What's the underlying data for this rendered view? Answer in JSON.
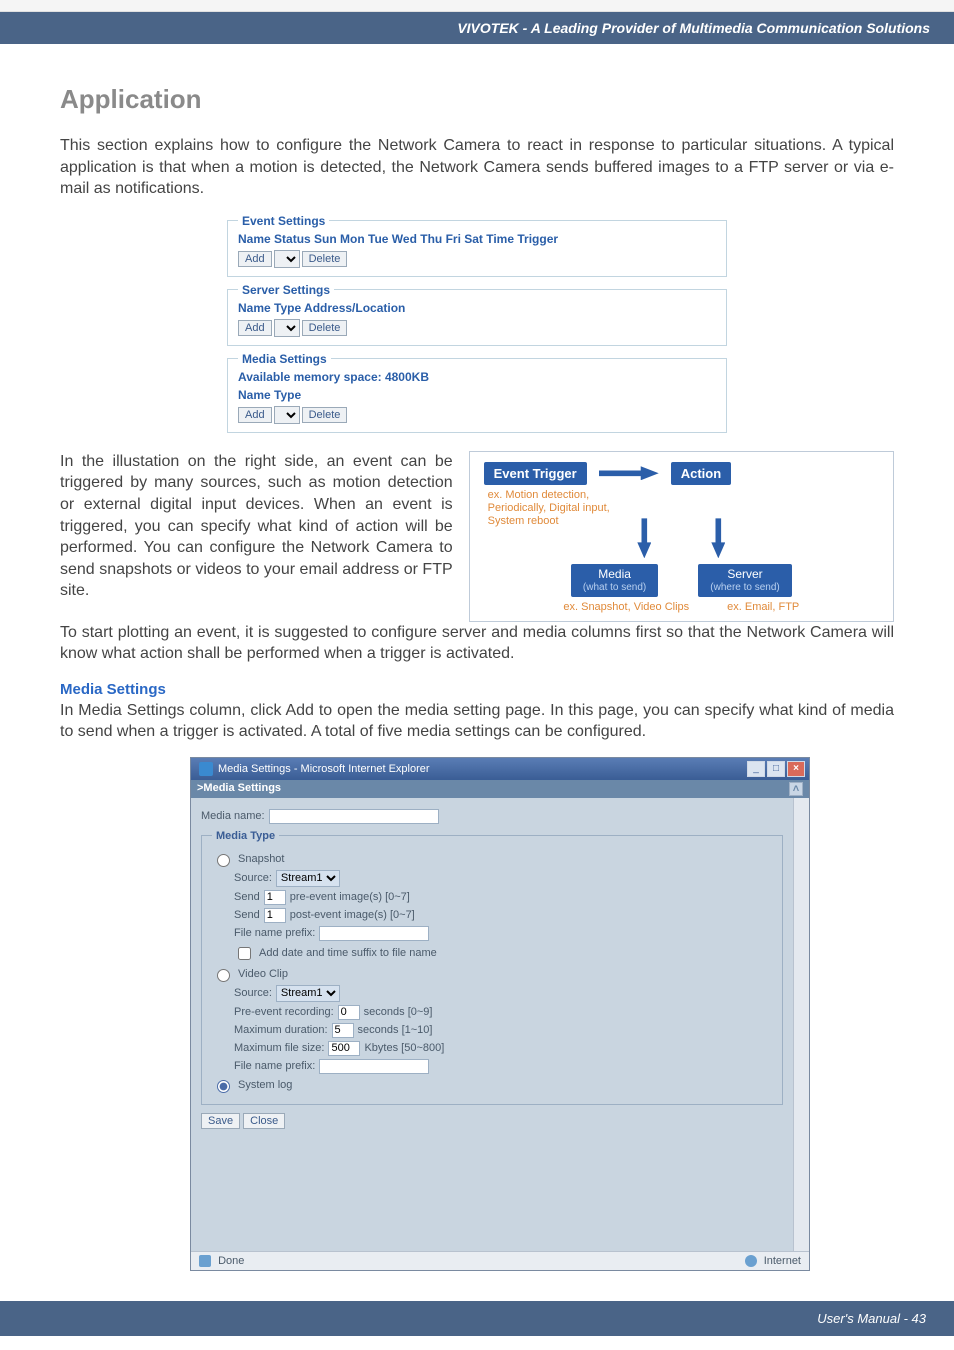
{
  "header": {
    "text": "VIVOTEK - A Leading Provider of Multimedia Communication Solutions"
  },
  "title": "Application",
  "intro": "This section explains how to configure the Network Camera to react in response to particular situations. A typical application is that when a motion is detected, the Network Camera sends buffered images to a FTP server or via e-mail as notifications.",
  "event_settings": {
    "legend": "Event Settings",
    "header_row": "Name Status Sun Mon Tue Wed Thu Fri Sat Time Trigger",
    "add": "Add",
    "delete": "Delete"
  },
  "server_settings": {
    "legend": "Server Settings",
    "header_row": "Name Type Address/Location",
    "add": "Add",
    "delete": "Delete"
  },
  "media_settings_box": {
    "legend": "Media Settings",
    "mem": "Available memory space: 4800KB",
    "header_row": "Name Type",
    "add": "Add",
    "delete": "Delete"
  },
  "illustration_para": "In the illustation on the right side, an event can be triggered by many sources, such as motion detection or external digital input devices. When an event is triggered, you can specify what kind of action will be performed. You can configure the Network Camera to send snapshots or videos to your email address or FTP site.",
  "diagram": {
    "event_trigger": "Event Trigger",
    "action": "Action",
    "ex1": "ex. Motion detection,\n   Periodically, Digital input,\n   System reboot",
    "media": "Media",
    "media_sub": "(what to send)",
    "server": "Server",
    "server_sub": "(where to send)",
    "ex_media": "ex. Snapshot, Video Clips",
    "ex_server": "ex. Email, FTP"
  },
  "plot_para": "To start plotting an event, it is suggested to configure server and media columns first so that the Network Camera will know what action shall be performed when a trigger is activated.",
  "media_head": "Media Settings",
  "media_para": "In Media Settings column, click Add to open the media setting page. In this page, you can specify what kind of media to send when a trigger is activated. A total of five media settings can be configured.",
  "ie": {
    "title": "Media Settings - Microsoft Internet Explorer",
    "subhead": ">Media Settings",
    "media_name_label": "Media name:",
    "media_name_value": "",
    "media_type_legend": "Media Type",
    "snapshot": {
      "label": "Snapshot",
      "source_label": "Source:",
      "source_value": "Stream1",
      "send1_label": "Send",
      "send1_value": "1",
      "send1_suffix": "pre-event image(s) [0~7]",
      "send2_label": "Send",
      "send2_value": "1",
      "send2_suffix": "post-event image(s) [0~7]",
      "prefix_label": "File name prefix:",
      "prefix_value": "",
      "suffix_chk": "Add date and time suffix to file name"
    },
    "video": {
      "label": "Video Clip",
      "source_label": "Source:",
      "source_value": "Stream1",
      "pre_label": "Pre-event recording:",
      "pre_value": "0",
      "pre_suffix": "seconds [0~9]",
      "dur_label": "Maximum duration:",
      "dur_value": "5",
      "dur_suffix": "seconds [1~10]",
      "size_label": "Maximum file size:",
      "size_value": "500",
      "size_suffix": "Kbytes [50~800]",
      "prefix_label": "File name prefix:",
      "prefix_value": ""
    },
    "syslog": "System log",
    "save": "Save",
    "close": "Close",
    "status_done": "Done",
    "status_zone": "Internet"
  },
  "footer": "User's Manual - 43"
}
